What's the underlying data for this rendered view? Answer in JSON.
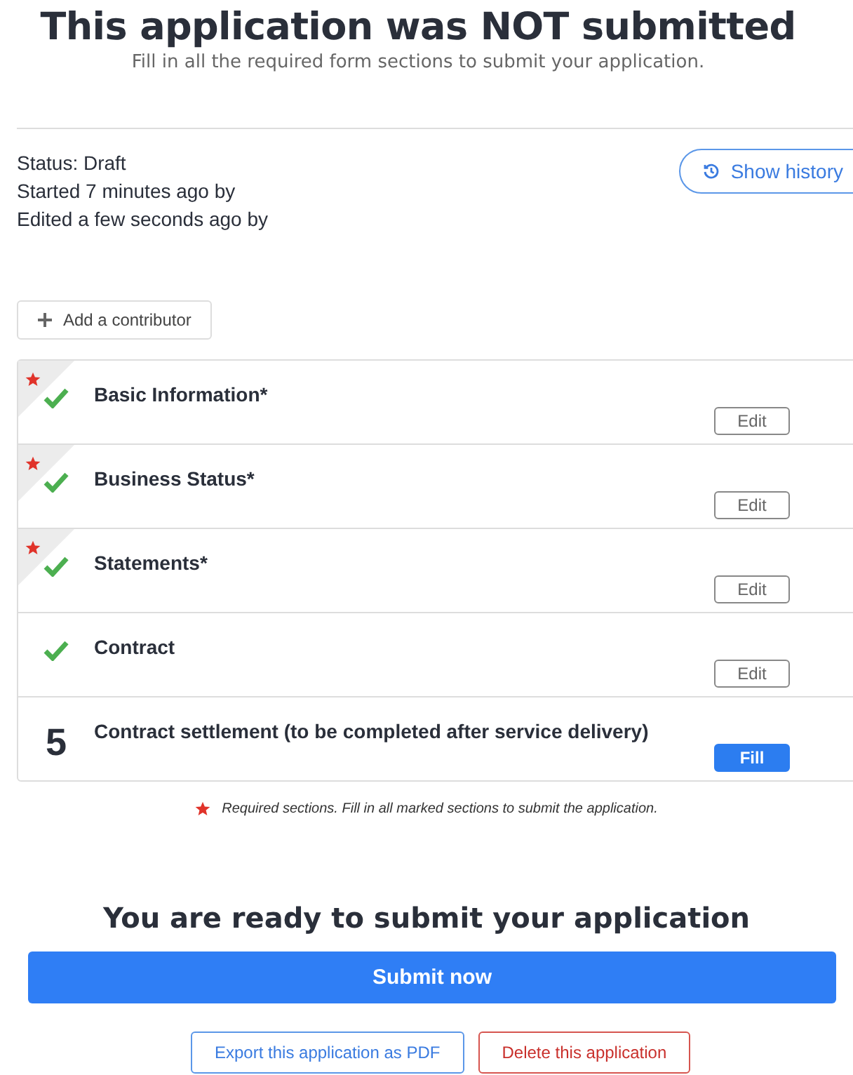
{
  "header": {
    "title": "This application was NOT submitted",
    "subtitle": "Fill in all the required form sections to submit your application."
  },
  "status": {
    "lines": [
      "Status: Draft",
      "Started 7 minutes ago by",
      "Edited a few seconds ago by"
    ],
    "history_button": "Show history"
  },
  "add_contributor": "Add a contributor",
  "sections": [
    {
      "title": "Basic Information*",
      "required": true,
      "kind": "done",
      "action": {
        "label": "Edit",
        "kind": "secondary"
      }
    },
    {
      "title": "Business Status*",
      "required": true,
      "kind": "done",
      "action": {
        "label": "Edit",
        "kind": "secondary"
      }
    },
    {
      "title": "Statements*",
      "required": true,
      "kind": "done",
      "action": {
        "label": "Edit",
        "kind": "secondary"
      }
    },
    {
      "title": "Contract",
      "required": false,
      "kind": "done",
      "action": {
        "label": "Edit",
        "kind": "secondary"
      }
    },
    {
      "title": "Contract settlement (to be completed after service delivery)",
      "required": false,
      "kind": "numbered",
      "number": "5",
      "action": {
        "label": "Fill",
        "kind": "primary"
      }
    }
  ],
  "footnote": "Required sections. Fill in all marked sections to submit the application.",
  "submit": {
    "heading": "You are ready to submit your application",
    "button": "Submit now"
  },
  "actions": [
    {
      "label": "Export this application as PDF",
      "kind": "export"
    },
    {
      "label": "Delete this application",
      "kind": "delete"
    }
  ]
}
